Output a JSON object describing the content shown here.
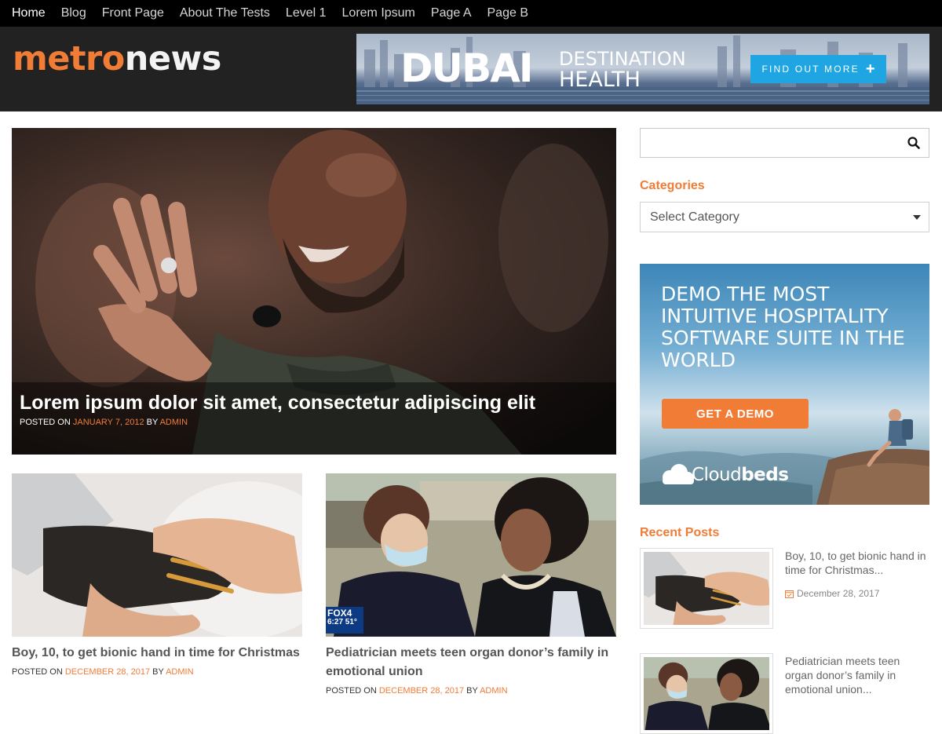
{
  "nav": {
    "items": [
      {
        "label": "Home"
      },
      {
        "label": "Blog"
      },
      {
        "label": "Front Page"
      },
      {
        "label": "About The Tests"
      },
      {
        "label": "Level 1"
      },
      {
        "label": "Lorem Ipsum"
      },
      {
        "label": "Page A"
      },
      {
        "label": "Page B"
      }
    ]
  },
  "brand": {
    "part1": "metro",
    "part2": "news",
    "colors": {
      "accent": "#f07c36",
      "header_bg": "#222222",
      "nav_bg": "#000000"
    }
  },
  "banner_ad": {
    "big": "DUBAI",
    "line1": "DESTINATION",
    "line2": "HEALTH",
    "button": "FIND OUT MORE"
  },
  "hero": {
    "title": "Lorem ipsum dolor sit amet, consectetur adipiscing elit",
    "meta": {
      "posted_on": "POSTED ON",
      "date": "JANUARY 7, 2012",
      "by": "BY",
      "author": "ADMIN"
    }
  },
  "posts": [
    {
      "title": "Boy, 10, to get bionic hand in time for Christmas",
      "meta": {
        "posted_on": "POSTED ON",
        "date": "DECEMBER 28, 2017",
        "by": "BY",
        "author": "ADMIN"
      }
    },
    {
      "title": "Pediatrician meets teen organ donor’s family in emotional union",
      "meta": {
        "posted_on": "POSTED ON",
        "date": "DECEMBER 28, 2017",
        "by": "BY",
        "author": "ADMIN"
      },
      "tv_logo": "FOX4",
      "tv_time": "6:27",
      "tv_temp": "51°"
    }
  ],
  "sidebar": {
    "search": {
      "placeholder": ""
    },
    "categories": {
      "title": "Categories",
      "selected": "Select Category"
    },
    "ad": {
      "text": "DEMO THE MOST INTUITIVE HOSPITALITY SOFTWARE SUITE IN THE WORLD",
      "button": "GET A DEMO",
      "brand_light": "Cloud",
      "brand_bold": "beds"
    },
    "recent_posts": {
      "title": "Recent Posts",
      "items": [
        {
          "title": "Boy, 10, to get bionic hand in time for Christmas...",
          "date": "December 28, 2017"
        },
        {
          "title": "Pediatrician meets teen organ donor’s family in emotional union...",
          "date": ""
        }
      ]
    }
  }
}
